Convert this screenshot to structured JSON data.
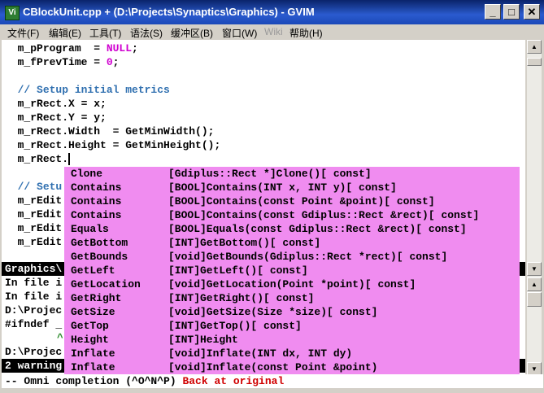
{
  "window": {
    "title": "CBlockUnit.cpp + (D:\\Projects\\Synaptics\\Graphics) - GVIM",
    "icon_label": "Vi"
  },
  "menu": [
    {
      "label": "文件(F)",
      "enabled": true
    },
    {
      "label": "编辑(E)",
      "enabled": true
    },
    {
      "label": "工具(T)",
      "enabled": true
    },
    {
      "label": "语法(S)",
      "enabled": true
    },
    {
      "label": "缓冲区(B)",
      "enabled": true
    },
    {
      "label": "窗口(W)",
      "enabled": true
    },
    {
      "label": "Wiki",
      "enabled": false
    },
    {
      "label": "帮助(H)",
      "enabled": true
    }
  ],
  "code": {
    "l1_a": "m_pProgram  = ",
    "l1_kw": "NULL",
    "l1_b": ";",
    "l2_a": "m_fPrevTime = ",
    "l2_num": "0",
    "l2_b": ";",
    "l4": "// Setup initial metrics",
    "l5": "m_rRect.X = x;",
    "l6": "m_rRect.Y = y;",
    "l7": "m_rRect.Width  = GetMinWidth();",
    "l8": "m_rRect.Height = GetMinHeight();",
    "l9": "m_rRect.",
    "l11": "// Setu",
    "l12": "m_rEdit",
    "l13": "m_rEdit",
    "l14": "m_rEdit",
    "l15": "m_rEdit"
  },
  "lower": {
    "status_label": "Graphics\\",
    "o1": "In file i",
    "o2": "In file i",
    "o3": "D:\\Projec",
    "o4": "#ifndef _",
    "o5": "^",
    "o6": "D:\\Projec",
    "warn": "2 warning"
  },
  "completion": [
    {
      "name": "Clone",
      "sig": "[Gdiplus::Rect *]Clone()[ const]"
    },
    {
      "name": "Contains",
      "sig": "[BOOL]Contains(INT x, INT y)[ const]"
    },
    {
      "name": "Contains",
      "sig": "[BOOL]Contains(const Point &point)[ const]"
    },
    {
      "name": "Contains",
      "sig": "[BOOL]Contains(const Gdiplus::Rect &rect)[ const]"
    },
    {
      "name": "Equals",
      "sig": "[BOOL]Equals(const Gdiplus::Rect &rect)[ const]"
    },
    {
      "name": "GetBottom",
      "sig": "[INT]GetBottom()[ const]"
    },
    {
      "name": "GetBounds",
      "sig": "[void]GetBounds(Gdiplus::Rect *rect)[ const]"
    },
    {
      "name": "GetLeft",
      "sig": "[INT]GetLeft()[ const]"
    },
    {
      "name": "GetLocation",
      "sig": "[void]GetLocation(Point *point)[ const]"
    },
    {
      "name": "GetRight",
      "sig": "[INT]GetRight()[ const]"
    },
    {
      "name": "GetSize",
      "sig": "[void]GetSize(Size *size)[ const]"
    },
    {
      "name": "GetTop",
      "sig": "[INT]GetTop()[ const]"
    },
    {
      "name": "Height",
      "sig": "[INT]Height"
    },
    {
      "name": "Inflate",
      "sig": "[void]Inflate(INT dx, INT dy)"
    },
    {
      "name": "Inflate",
      "sig": "[void]Inflate(const Point &point)"
    }
  ],
  "cmdline": {
    "mode": "-- Omni completion (^O^N^P) ",
    "msg": "Back at original"
  },
  "colors": {
    "popup_bg": "#f08cf0",
    "keyword": "#d000d0",
    "comment": "#3070b0",
    "message": "#d00000"
  }
}
